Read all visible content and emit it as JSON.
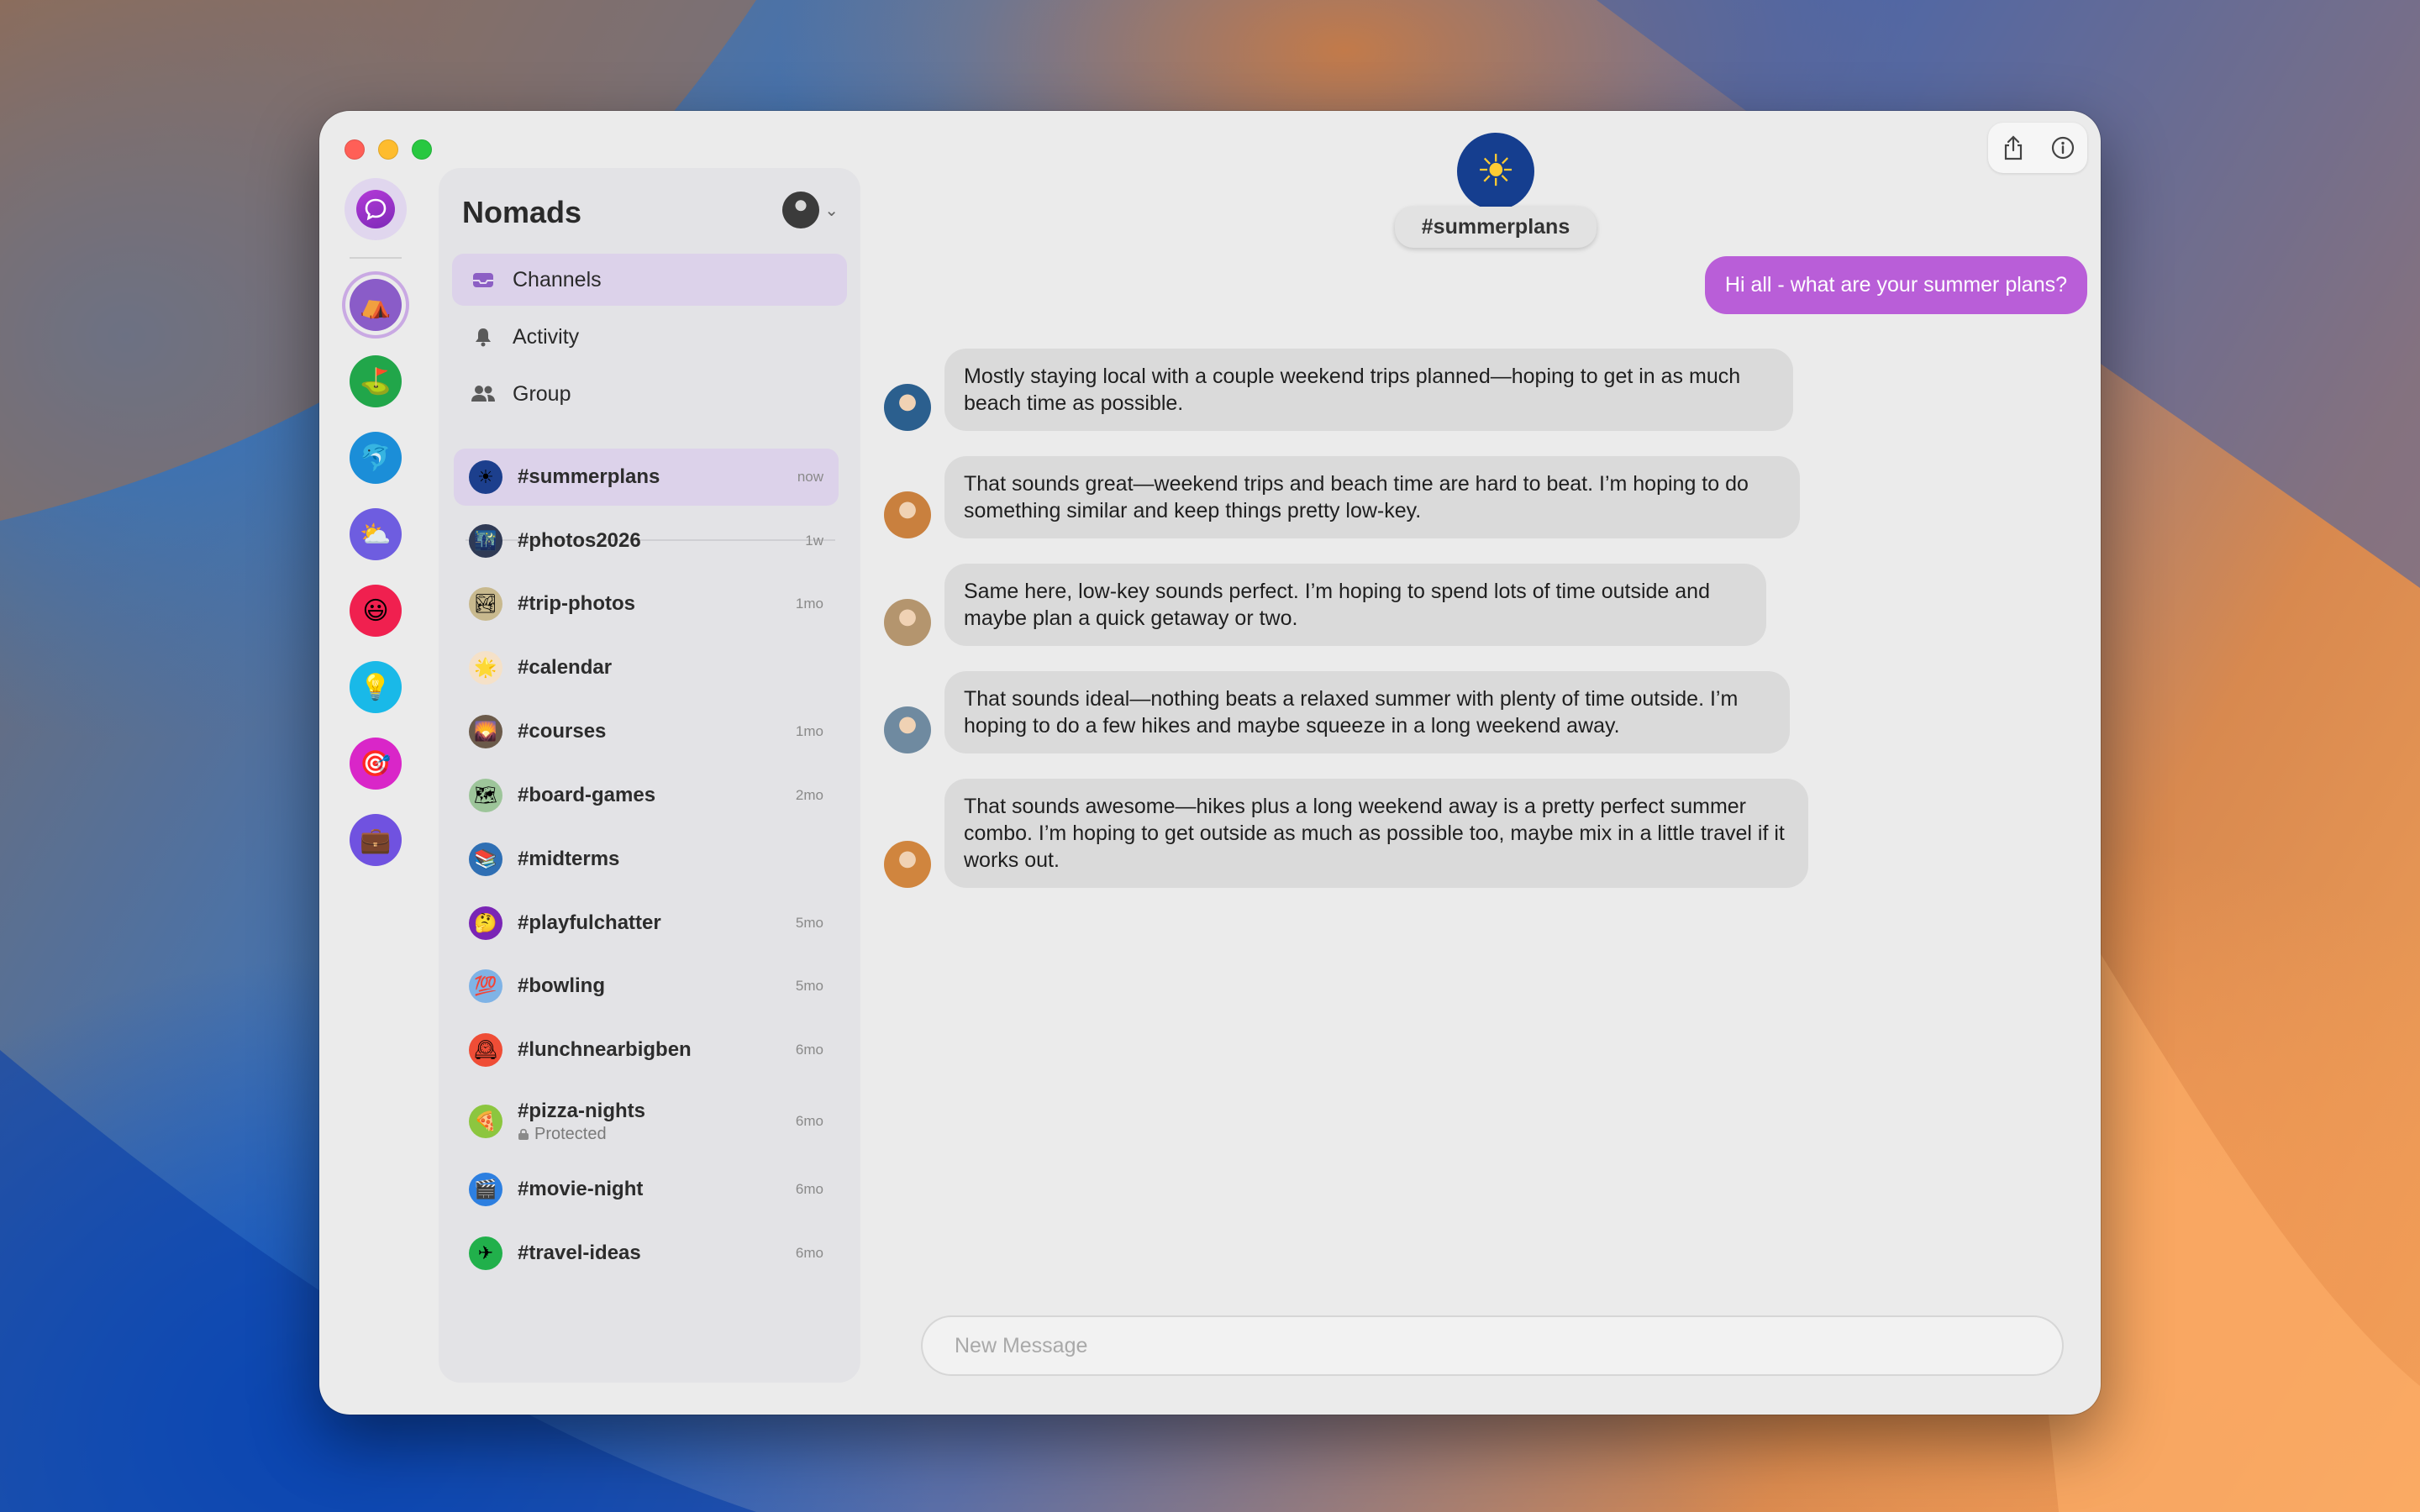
{
  "window": {
    "team_name": "Nomads"
  },
  "rail": {
    "home_icon": "chat-bubble-icon",
    "spaces": [
      {
        "name": "tent",
        "icon": "⛺",
        "color": "#8a5cc8",
        "active": true
      },
      {
        "name": "golf",
        "icon": "⛳",
        "color": "#21a64a"
      },
      {
        "name": "dolphin",
        "icon": "🐬",
        "color": "#1b8ed8"
      },
      {
        "name": "cloud",
        "icon": "⛅",
        "color": "#6e5de0"
      },
      {
        "name": "smiley",
        "icon": "😃",
        "color": "#f0204f"
      },
      {
        "name": "lightbulb",
        "icon": "💡",
        "color": "#19b9e8"
      },
      {
        "name": "target",
        "icon": "🎯",
        "color": "#d926c8"
      },
      {
        "name": "briefcase",
        "icon": "💼",
        "color": "#7052e0"
      }
    ]
  },
  "nav": {
    "channels": "Channels",
    "activity": "Activity",
    "group": "Group"
  },
  "channels": [
    {
      "name": "#summerplans",
      "time": "now",
      "icon": "☀",
      "color": "#1c3f8d",
      "selected": true
    },
    {
      "name": "#photos2026",
      "time": "1w",
      "icon": "🌃",
      "color": "#2f3a55"
    },
    {
      "name": "#trip-photos",
      "time": "1mo",
      "icon": "🏞",
      "color": "#c8b98e"
    },
    {
      "name": "#calendar",
      "time": "",
      "icon": "🌟",
      "color": "#f5e1c8"
    },
    {
      "name": "#courses",
      "time": "1mo",
      "icon": "🌄",
      "color": "#6b5a4a"
    },
    {
      "name": "#board-games",
      "time": "2mo",
      "icon": "🗺",
      "color": "#9dc59a"
    },
    {
      "name": "#midterms",
      "time": "",
      "icon": "📚",
      "color": "#2f6fb4"
    },
    {
      "name": "#playfulchatter",
      "time": "5mo",
      "icon": "🤔",
      "color": "#7a25b5"
    },
    {
      "name": "#bowling",
      "time": "5mo",
      "icon": "💯",
      "color": "#7fb3e6"
    },
    {
      "name": "#lunchnearbigben",
      "time": "6mo",
      "icon": "🕰",
      "color": "#ef4d36"
    },
    {
      "name": "#pizza-nights",
      "time": "6mo",
      "icon": "🍕",
      "color": "#8cc63f",
      "subtitle": "Protected"
    },
    {
      "name": "#movie-night",
      "time": "6mo",
      "icon": "🎬",
      "color": "#2d7fe0"
    },
    {
      "name": "#travel-ideas",
      "time": "6mo",
      "icon": "✈",
      "color": "#21b04b"
    }
  ],
  "chat": {
    "channel_name": "#summerplans",
    "channel_icon": "☀",
    "outgoing": "Hi all - what are your summer plans?",
    "messages": [
      {
        "text": "Mostly staying local with a couple weekend trips planned—hoping to get in as much beach time as possible.",
        "avatar_color": "#2b5f8e"
      },
      {
        "text": "That sounds great—weekend trips and beach time are hard to beat. I’m hoping to do something similar and keep things pretty low-key.",
        "avatar_color": "#c9803e"
      },
      {
        "text": "Same here, low-key sounds perfect. I’m hoping to spend lots of time outside and maybe plan a quick getaway or two.",
        "avatar_color": "#b4956e"
      },
      {
        "text": "That sounds ideal—nothing beats a relaxed summer with plenty of time outside. I’m hoping to do a few hikes and maybe squeeze in a long weekend away.",
        "avatar_color": "#6f8aa0"
      },
      {
        "text": "That sounds awesome—hikes plus a long weekend away is a pretty perfect summer combo. I’m hoping to get outside as much as possible too, maybe mix in a little travel if it works out.",
        "avatar_color": "#d0853e"
      }
    ],
    "composer_placeholder": "New Message"
  }
}
